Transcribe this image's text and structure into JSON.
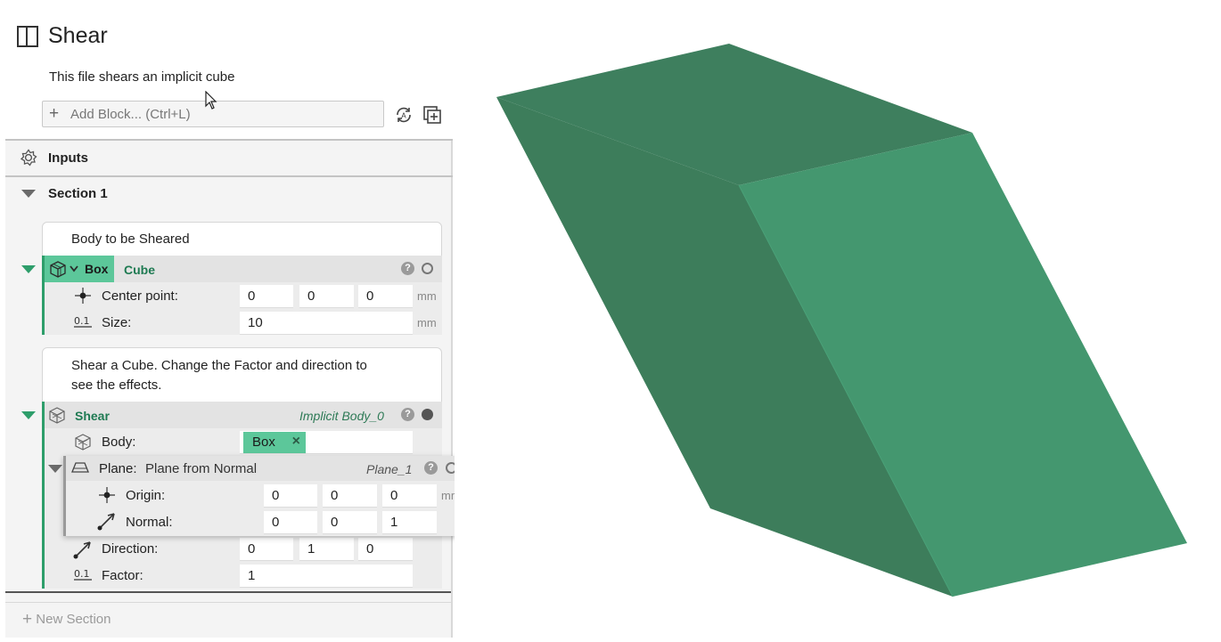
{
  "file": {
    "title": "Shear",
    "description": "This file shears an implicit cube",
    "add_block_placeholder": "Add Block... (Ctrl+L)"
  },
  "inputs": {
    "label": "Inputs"
  },
  "section": {
    "label": "Section 1"
  },
  "box_block": {
    "comment": "Body to be Sheared",
    "type_label": "Box",
    "name": "Cube",
    "center_label": "Center point:",
    "center_values": [
      "0",
      "0",
      "0"
    ],
    "center_unit": "mm",
    "size_label": "Size:",
    "size_value": "10",
    "size_unit": "mm"
  },
  "shear_block": {
    "comment_line1": "Shear a Cube. Change the Factor and direction to",
    "comment_line2": "see the effects.",
    "type_label": "Shear",
    "output_name": "Implicit Body_0",
    "body_label": "Body:",
    "body_chip": "Box",
    "plane_label": "Plane:",
    "plane_type": "Plane from Normal",
    "plane_name": "Plane_1",
    "origin_label": "Origin:",
    "origin_values": [
      "0",
      "0",
      "0"
    ],
    "origin_unit": "mm",
    "normal_label": "Normal:",
    "normal_values": [
      "0",
      "0",
      "1"
    ],
    "direction_label": "Direction:",
    "direction_values": [
      "0",
      "1",
      "0"
    ],
    "factor_label": "Factor:",
    "factor_value": "1"
  },
  "new_section_label": "New Section",
  "colors": {
    "accent_green": "#2e9e6b",
    "tag_green": "#5cc79a",
    "shape_top": "#3e7f5e",
    "shape_front_left": "#3d7d5b",
    "shape_front_right": "#44976f"
  },
  "icons": [
    "panel-icon",
    "plus-icon",
    "sync-icon",
    "duplicate-icon",
    "inputs-gear-icon",
    "cube-icon",
    "shear-icon",
    "point-icon",
    "scalar-icon",
    "plane-icon",
    "vector-icon",
    "help-icon",
    "cursor-icon"
  ]
}
